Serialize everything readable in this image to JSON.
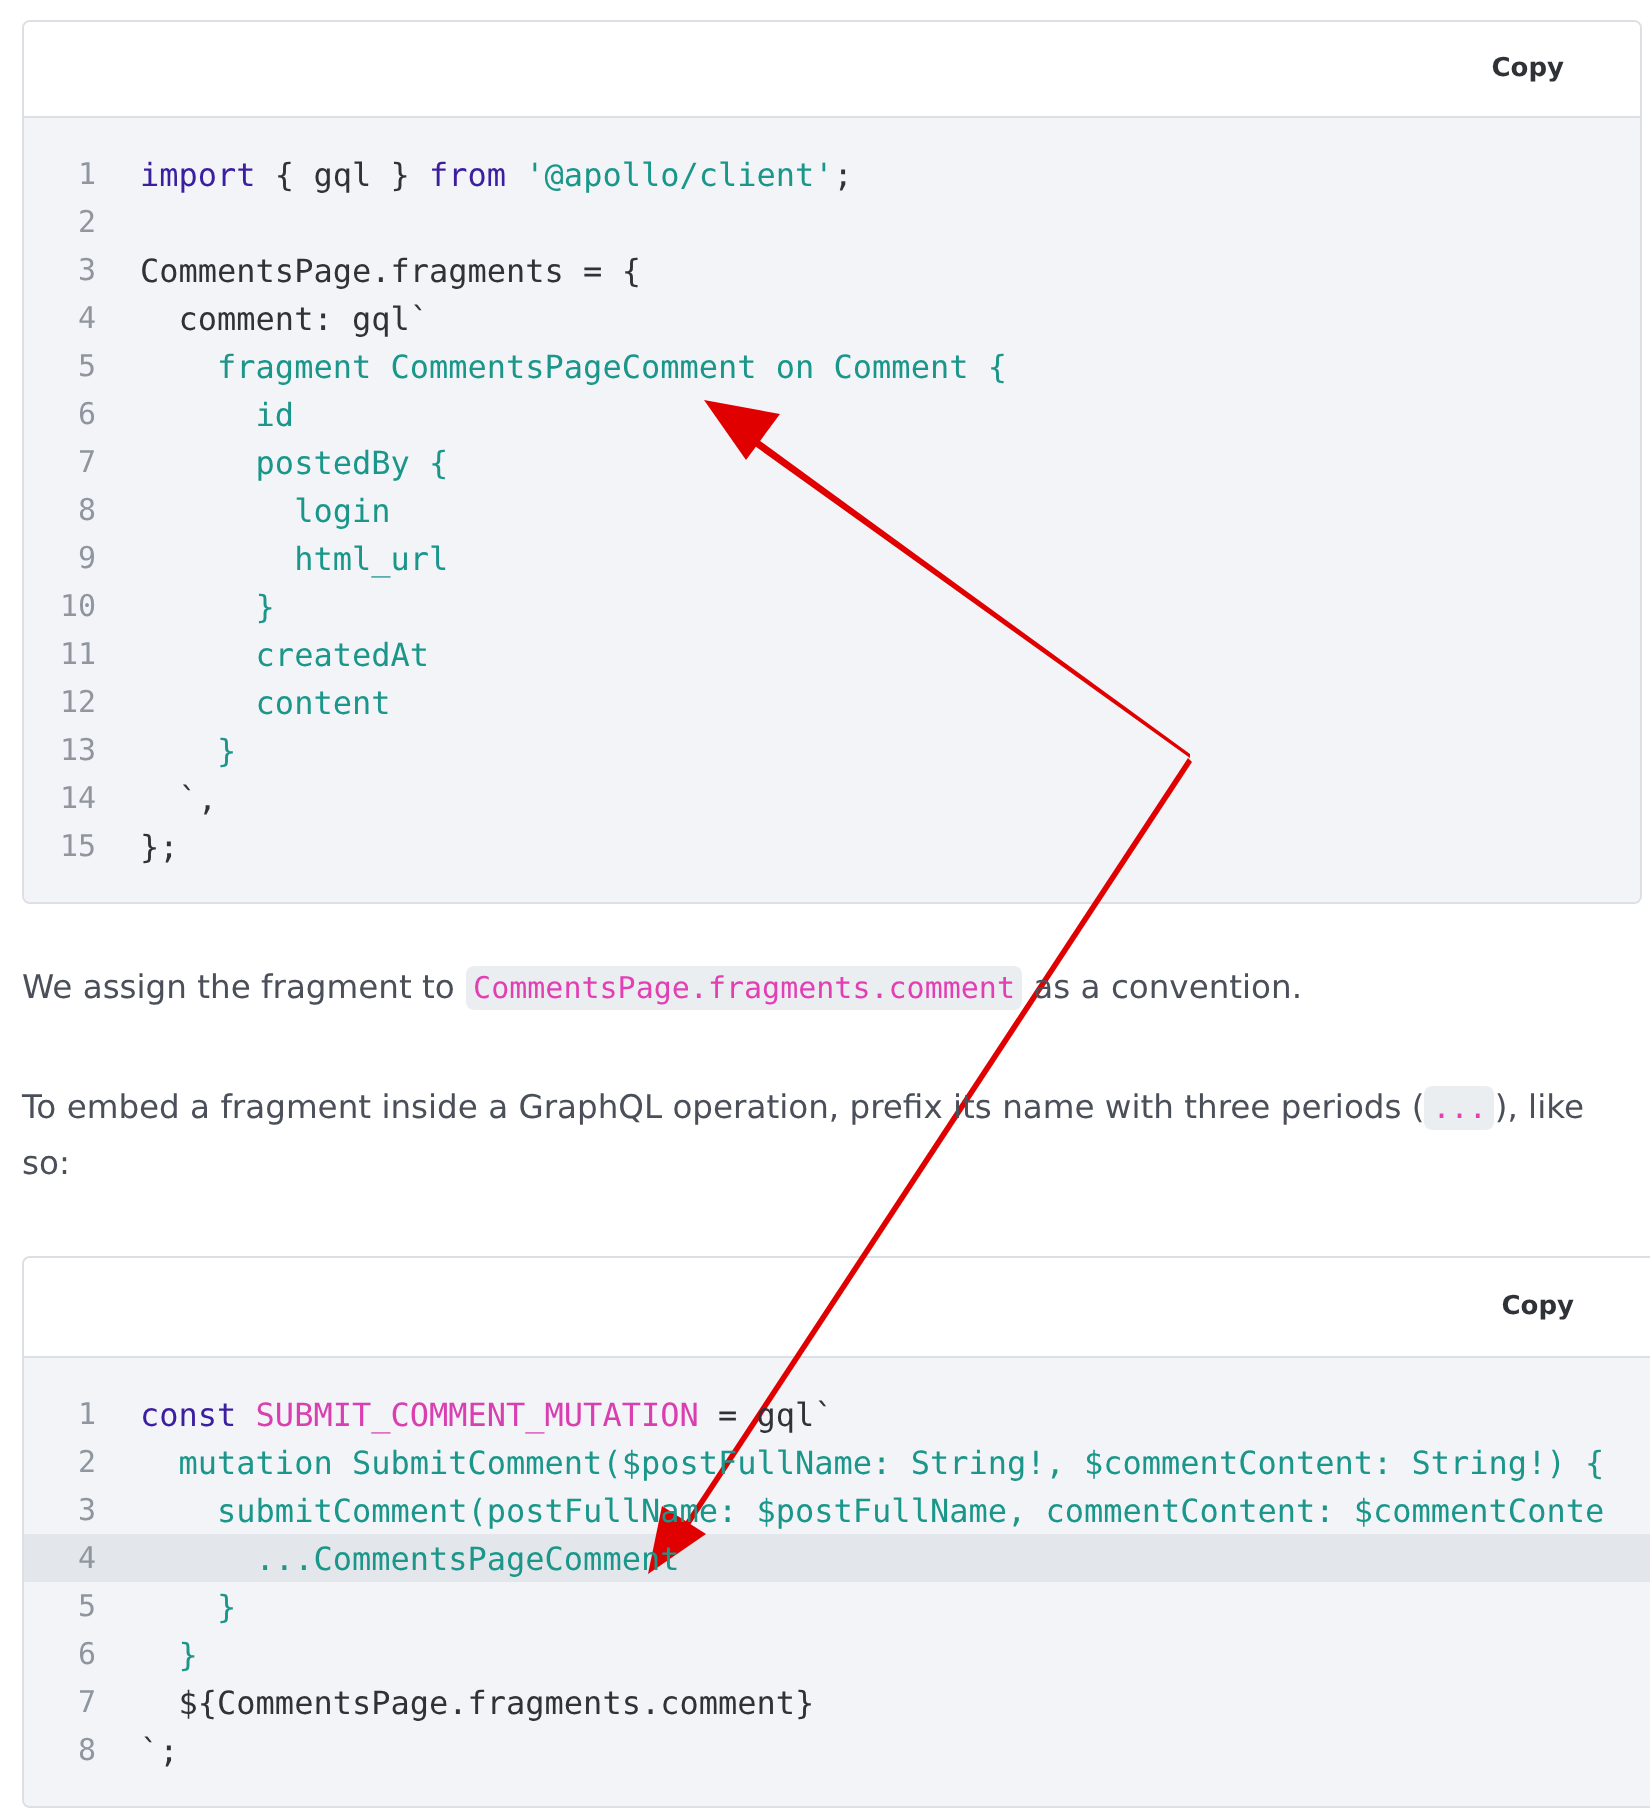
{
  "content": [
    {
      "kind": "code_block",
      "copy_button": "Copy",
      "lines": [
        {
          "number": "1",
          "highlighted": false,
          "tokens": [
            {
              "kind": "keyword",
              "text": "import"
            },
            {
              "kind": "plain",
              "text": " { gql } "
            },
            {
              "kind": "keyword",
              "text": "from"
            },
            {
              "kind": "string",
              "text": " '@apollo/client'"
            },
            {
              "kind": "plain",
              "text": ";"
            }
          ]
        },
        {
          "number": "2",
          "highlighted": false
        },
        {
          "number": "3",
          "highlighted": false,
          "tokens": [
            {
              "kind": "plain",
              "text": "CommentsPage.fragments = {"
            }
          ]
        },
        {
          "number": "4",
          "highlighted": false,
          "tokens": [
            {
              "kind": "plain",
              "text": "  comment: gql`"
            }
          ]
        },
        {
          "number": "5",
          "highlighted": false,
          "tokens": [
            {
              "kind": "string",
              "text": "    fragment CommentsPageComment on Comment {"
            }
          ]
        },
        {
          "number": "6",
          "highlighted": false,
          "tokens": [
            {
              "kind": "string",
              "text": "      id"
            }
          ]
        },
        {
          "number": "7",
          "highlighted": false,
          "tokens": [
            {
              "kind": "string",
              "text": "      postedBy {"
            }
          ]
        },
        {
          "number": "8",
          "highlighted": false,
          "tokens": [
            {
              "kind": "string",
              "text": "        login"
            }
          ]
        },
        {
          "number": "9",
          "highlighted": false,
          "tokens": [
            {
              "kind": "string",
              "text": "        html_url"
            }
          ]
        },
        {
          "number": "10",
          "highlighted": false,
          "tokens": [
            {
              "kind": "string",
              "text": "      }"
            }
          ]
        },
        {
          "number": "11",
          "highlighted": false,
          "tokens": [
            {
              "kind": "string",
              "text": "      createdAt"
            }
          ]
        },
        {
          "number": "12",
          "highlighted": false,
          "tokens": [
            {
              "kind": "string",
              "text": "      content"
            }
          ]
        },
        {
          "number": "13",
          "highlighted": false,
          "tokens": [
            {
              "kind": "string",
              "text": "    }"
            }
          ]
        },
        {
          "number": "14",
          "highlighted": false,
          "tokens": [
            {
              "kind": "plain",
              "text": "  `,"
            }
          ]
        },
        {
          "number": "15",
          "highlighted": false,
          "tokens": [
            {
              "kind": "plain",
              "text": "};"
            }
          ]
        }
      ]
    },
    {
      "kind": "paragraph",
      "parts": [
        {
          "kind": "text",
          "text": "We assign the fragment to "
        },
        {
          "kind": "code",
          "text": "CommentsPage.fragments.comment"
        },
        {
          "kind": "text",
          "text": " as a convention."
        }
      ]
    },
    {
      "kind": "paragraph",
      "parts": [
        {
          "kind": "text",
          "text": "To embed a fragment inside a GraphQL operation, prefix its name with three periods ("
        },
        {
          "kind": "code",
          "text": "..."
        },
        {
          "kind": "text",
          "text": "), like so:"
        }
      ]
    },
    {
      "kind": "code_block",
      "copy_button": "Copy",
      "lines": [
        {
          "number": "1",
          "highlighted": false,
          "tokens": [
            {
              "kind": "keyword",
              "text": "const "
            },
            {
              "kind": "constant",
              "text": "SUBMIT_COMMENT_MUTATION"
            },
            {
              "kind": "plain",
              "text": " = gql`"
            }
          ]
        },
        {
          "number": "2",
          "highlighted": false,
          "tokens": [
            {
              "kind": "string",
              "text": "  mutation SubmitComment($postFullName: String!, $commentContent: String!) {"
            }
          ]
        },
        {
          "number": "3",
          "highlighted": false,
          "tokens": [
            {
              "kind": "string",
              "text": "    submitComment(postFullName: $postFullName, commentContent: $commentConte"
            }
          ]
        },
        {
          "number": "4",
          "highlighted": true,
          "tokens": [
            {
              "kind": "string",
              "text": "      ...CommentsPageComment"
            }
          ]
        },
        {
          "number": "5",
          "highlighted": false,
          "tokens": [
            {
              "kind": "string",
              "text": "    }"
            }
          ]
        },
        {
          "number": "6",
          "highlighted": false,
          "tokens": [
            {
              "kind": "string",
              "text": "  }"
            }
          ]
        },
        {
          "number": "7",
          "highlighted": false,
          "tokens": [
            {
              "kind": "plain",
              "text": "  ${CommentsPage.fragments.comment}"
            }
          ]
        },
        {
          "number": "8",
          "highlighted": false,
          "tokens": [
            {
              "kind": "plain",
              "text": "`;"
            }
          ]
        }
      ]
    }
  ]
}
